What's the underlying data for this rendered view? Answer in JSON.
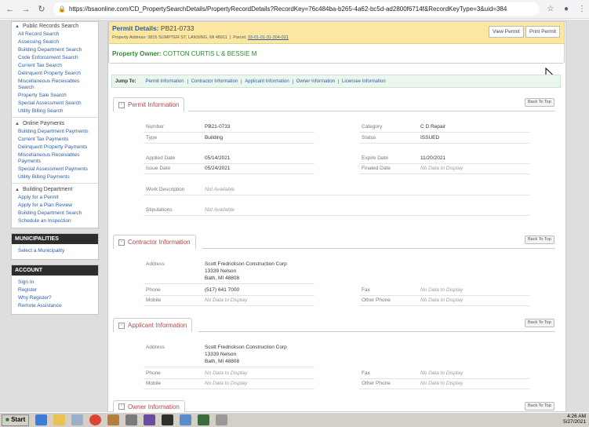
{
  "browser": {
    "url": "https://bsaonline.com/CD_PropertySearchDetails/PropertyRecordDetails?RecordKey=76c484ba-b265-4a62-bc5d-ad2800f6714f&RecordKeyType=3&uid=384",
    "back_icon": "arrow-left-icon",
    "forward_icon": "arrow-right-icon",
    "reload_icon": "reload-icon",
    "star_icon": "star-icon",
    "profile_icon": "person-icon",
    "menu_icon": "dots-menu-icon"
  },
  "sidebar": {
    "public_records": {
      "heading": "Public Records Search",
      "items": [
        "All Record Search",
        "Assessing Search",
        "Building Department Search",
        "Code Enforcement Search",
        "Current Tax Search",
        "Delinquent Property Search",
        "Miscellaneous Receivables Search",
        "Property Sale Search",
        "Special Assessment Search",
        "Utility Billing Search"
      ]
    },
    "online_payments": {
      "heading": "Online Payments",
      "items": [
        "Building Department Payments",
        "Current Tax Payments",
        "Delinquent Property Payments",
        "Miscellaneous Receivables Payments",
        "Special Assessment Payments",
        "Utility Billing Payments"
      ]
    },
    "building_department": {
      "heading": "Building Department",
      "items": [
        "Apply for a Permit",
        "Apply for a Plan Review",
        "Building Department Search",
        "Schedule an Inspection"
      ]
    },
    "municipalities": {
      "heading": "MUNICIPALITIES",
      "items": [
        "Select a Municipality"
      ]
    },
    "account": {
      "heading": "ACCOUNT",
      "items": [
        "Sign In",
        "Register",
        "Why Register?",
        "Remote Assistance"
      ]
    }
  },
  "permit_header": {
    "title_label": "Permit Details:",
    "permit_number": "PB21-0733",
    "address_label": "Property Address:",
    "address": "3815 SUMPTER ST, LANSING, MI 48911",
    "parcel_label": "Parcel:",
    "parcel": "33-01-01-31-304-021",
    "view_button": "View Permit",
    "print_button": "Print Permit",
    "owner_label": "Property Owner:",
    "owner": "COTTON CURTIS L & BESSIE M"
  },
  "jump_to": {
    "label": "Jump To:",
    "links": [
      "Permit Information",
      "Contractor Information",
      "Applicant Information",
      "Owner Information",
      "Licensee Information"
    ]
  },
  "back_to_top": "Back To Top",
  "permit_info": {
    "heading": "Permit Information",
    "number_label": "Number",
    "number": "PB21-0733",
    "type_label": "Type",
    "type": "Building",
    "category_label": "Category",
    "category": "C D Repair",
    "status_label": "Status",
    "status": "ISSUED",
    "applied_label": "Applied Date",
    "applied": "05/14/2021",
    "expire_label": "Expire Date",
    "expire": "11/20/2021",
    "issue_label": "Issue Date",
    "issue": "05/24/2021",
    "finaled_label": "Finaled Date",
    "finaled": "No Data to Display",
    "work_label": "Work Description",
    "work": "Not Available",
    "stip_label": "Stipulations",
    "stip": "Not Available"
  },
  "contractor_info": {
    "heading": "Contractor Information",
    "address_label": "Address",
    "address_line1": "Scott Fredrickson Construction Corp",
    "address_line2": "13339 Nelson",
    "address_line3": "Bath, MI 48808",
    "phone_label": "Phone",
    "phone": "(517) 641 7000",
    "fax_label": "Fax",
    "fax": "No Data to Display",
    "mobile_label": "Mobile",
    "mobile": "No Data to Display",
    "other_label": "Other Phone",
    "other": "No Data to Display"
  },
  "applicant_info": {
    "heading": "Applicant Information",
    "address_label": "Address",
    "address_line1": "Scott Fredrickson Construction Corp",
    "address_line2": "13339 Nelson",
    "address_line3": "Bath, MI 48808",
    "phone_label": "Phone",
    "phone": "No Data to Display",
    "fax_label": "Fax",
    "fax": "No Data to Display",
    "mobile_label": "Mobile",
    "mobile": "No Data to Display",
    "other_label": "Other Phone",
    "other": "No Data to Display"
  },
  "owner_info": {
    "heading": "Owner Information"
  },
  "taskbar": {
    "start": "Start",
    "time": "4:26 AM",
    "date": "5/27/2021"
  },
  "colors": {
    "accent_blue": "#2b5ea8",
    "owner_green": "#2e8b2e",
    "header_yellow": "#fbe7a1",
    "section_red": "#b04a4a"
  }
}
